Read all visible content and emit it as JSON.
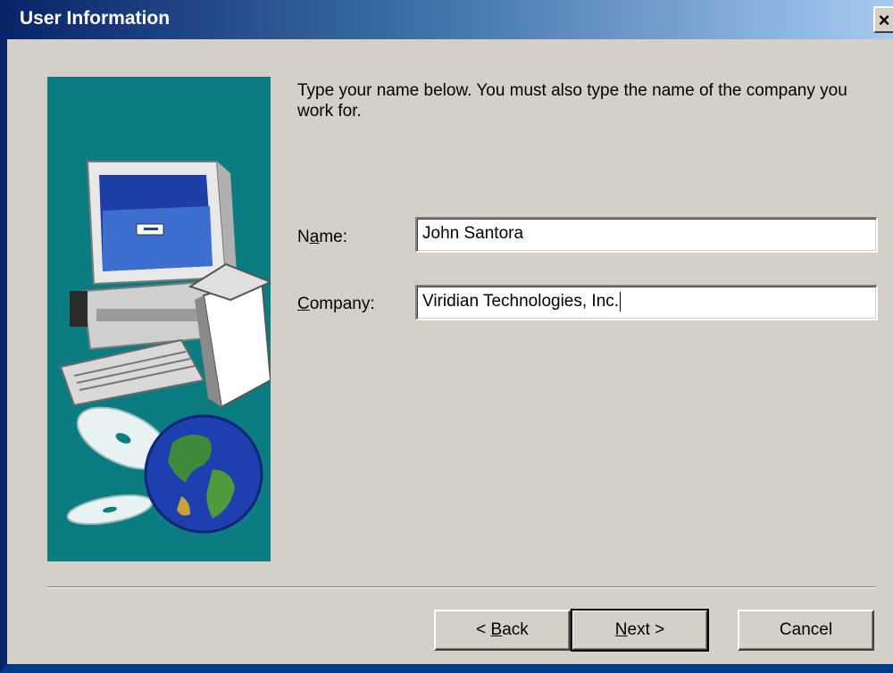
{
  "window": {
    "title": "User Information",
    "close_glyph": "✕"
  },
  "main": {
    "instructions": "Type your name below. You must also type the name of the company you work for.",
    "name_label_prefix": "N",
    "name_label_accel": "a",
    "name_label_suffix": "me:",
    "name_value": "John Santora",
    "company_label_accel": "C",
    "company_label_suffix": "ompany:",
    "company_value": "Viridian Technologies, Inc."
  },
  "buttons": {
    "back_prefix": "< ",
    "back_accel": "B",
    "back_suffix": "ack",
    "next_accel": "N",
    "next_suffix": "ext >",
    "cancel": "Cancel"
  },
  "illustration": {
    "icons": [
      "computer-icon",
      "cd-icon",
      "globe-icon"
    ],
    "background_color": "#0b7d82"
  }
}
